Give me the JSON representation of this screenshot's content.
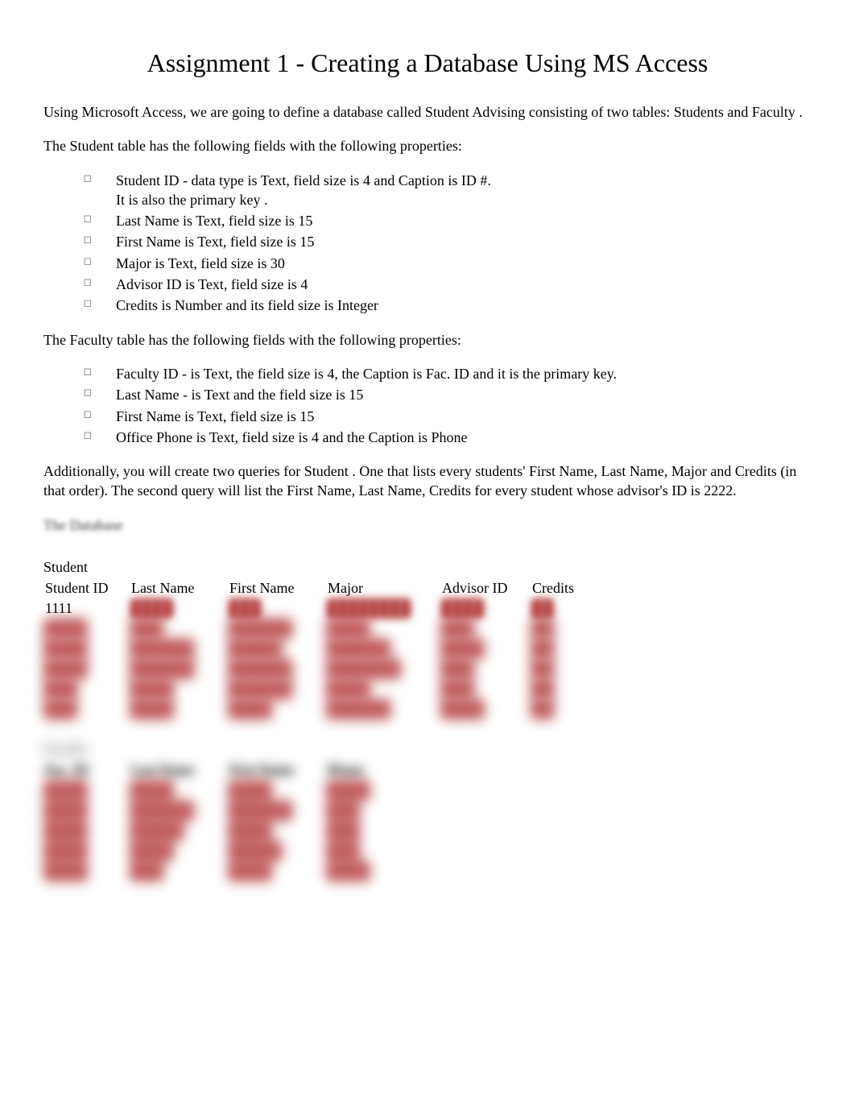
{
  "title": "Assignment 1 - Creating a Database Using MS Access",
  "intro": {
    "p1a": "Using Microsoft Access, we are going to define a database called ",
    "p1b": "Student Advising",
    "p1c": "   consisting of two tables: ",
    "p1d": "Students",
    "p1e": "  and ",
    "p1f": "Faculty",
    "p1g": " ."
  },
  "student_intro": "The Student table has the following fields with the following properties:",
  "student_fields": [
    {
      "line1": "Student ID  - data type is Text, field size is 4 and Caption is ID #.",
      "line2": "It is also the primary key ."
    },
    {
      "line1": "Last Name  is Text, field size is 15"
    },
    {
      "line1": "First Name  is Text, field size is 15"
    },
    {
      "line1": "Major  is Text, field size is 30"
    },
    {
      "line1": "Advisor ID  is Text, field size is 4"
    },
    {
      "line1": "Credits  is Number and its field size is Integer"
    }
  ],
  "faculty_intro": "The Faculty table has the following fields with the following properties:",
  "faculty_fields": [
    {
      "line1": "Faculty ID  - is Text, the field size is 4, the Caption is Fac. ID and it is the primary key."
    },
    {
      "line1": "Last Name  - is Text and the field size is 15"
    },
    {
      "line1": "First Name  is Text, field size is 15"
    },
    {
      "line1": "Office Phone  is Text, field size is 4 and the Caption is Phone"
    }
  ],
  "queries_para": "Additionally, you will create two queries for Student . One that lists every students' First Name, Last Name, Major and Credits (in that order). The second query will list the First Name, Last Name, Credits for every student whose advisor's ID is 2222.",
  "db_heading": "The Database",
  "student_table": {
    "title": "Student",
    "headers": [
      "Student ID",
      "Last Name",
      "First Name",
      "Major",
      "Advisor ID",
      "Credits"
    ],
    "rows": [
      {
        "id": "1111",
        "ln": "████",
        "fn": "███",
        "maj": "████████",
        "aid": "████",
        "cr": "██"
      },
      {
        "id": "████",
        "ln": "███",
        "fn": "██████",
        "maj": "████",
        "aid": "███",
        "cr": "██"
      },
      {
        "id": "████",
        "ln": "██████",
        "fn": "█████",
        "maj": "██████",
        "aid": "████",
        "cr": "██"
      },
      {
        "id": "████",
        "ln": "██████",
        "fn": "██████",
        "maj": "███████",
        "aid": "███",
        "cr": "██"
      },
      {
        "id": "███",
        "ln": "████",
        "fn": "██████",
        "maj": "████",
        "aid": "███",
        "cr": "██"
      },
      {
        "id": "███",
        "ln": "████",
        "fn": "████",
        "maj": "██████",
        "aid": "████",
        "cr": "██"
      }
    ]
  },
  "faculty_table": {
    "title": "Faculty",
    "headers": [
      "Fac. ID",
      "Last Name",
      "First Name",
      "Phone"
    ],
    "rows": [
      {
        "id": "████",
        "ln": "████",
        "fn": "████",
        "ph": "████"
      },
      {
        "id": "████",
        "ln": "██████",
        "fn": "██████",
        "ph": "███"
      },
      {
        "id": "████",
        "ln": "█████",
        "fn": "████",
        "ph": "███"
      },
      {
        "id": "████",
        "ln": "████",
        "fn": "█████",
        "ph": "███"
      },
      {
        "id": "████",
        "ln": "███",
        "fn": "████",
        "ph": "████"
      }
    ]
  }
}
